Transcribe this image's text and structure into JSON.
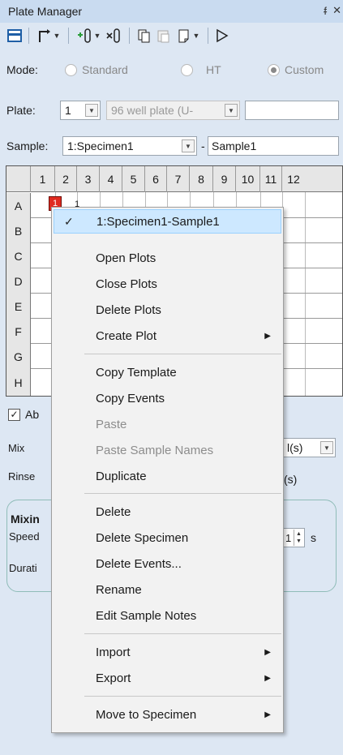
{
  "panel": {
    "title": "Plate Manager",
    "pin": "ᵮ",
    "close": "×"
  },
  "mode": {
    "label": "Mode:",
    "options": [
      {
        "label": "Standard"
      },
      {
        "label": "HT"
      },
      {
        "label": "Custom"
      }
    ]
  },
  "plate": {
    "label": "Plate:",
    "number": "1",
    "type": "96 well plate (U-",
    "name": ""
  },
  "sample": {
    "label": "Sample:",
    "specimen": "1:Specimen1",
    "separator": "-",
    "name": "Sample1"
  },
  "grid": {
    "columns": [
      "1",
      "2",
      "3",
      "4",
      "5",
      "6",
      "7",
      "8",
      "9",
      "10",
      "11",
      "12"
    ],
    "rows": [
      "A",
      "B",
      "C",
      "D",
      "E",
      "F",
      "G",
      "H"
    ],
    "well_a1": "1",
    "well_a2": "1"
  },
  "lower": {
    "checkbox_label": "Ab",
    "mix_label": "Mix",
    "mix_value": "l(s)",
    "rinse_label": "Rinse",
    "rinse_value": "(s)",
    "group_title": "Mixin",
    "speed_label": "Speed",
    "speed_value": "1",
    "speed_unit": "s",
    "duration_label": "Durati"
  },
  "context_menu": {
    "items": [
      {
        "label": "1:Specimen1-Sample1",
        "checked": true
      },
      {
        "label": "Open Plots"
      },
      {
        "label": "Close Plots"
      },
      {
        "label": "Delete Plots"
      },
      {
        "label": "Create Plot",
        "submenu": true
      },
      {
        "label": "Copy Template"
      },
      {
        "label": "Copy Events"
      },
      {
        "label": "Paste",
        "disabled": true
      },
      {
        "label": "Paste Sample Names",
        "disabled": true
      },
      {
        "label": "Duplicate"
      },
      {
        "label": "Delete"
      },
      {
        "label": "Delete Specimen"
      },
      {
        "label": "Delete Events..."
      },
      {
        "label": "Rename"
      },
      {
        "label": "Edit Sample Notes"
      },
      {
        "label": "Import",
        "submenu": true
      },
      {
        "label": "Export",
        "submenu": true
      },
      {
        "label": "Move to Specimen",
        "submenu": true
      }
    ]
  },
  "colors": {
    "accent": "#c9dbf0",
    "well_selected": "#e02b20",
    "menu_highlight": "#cde8ff"
  }
}
